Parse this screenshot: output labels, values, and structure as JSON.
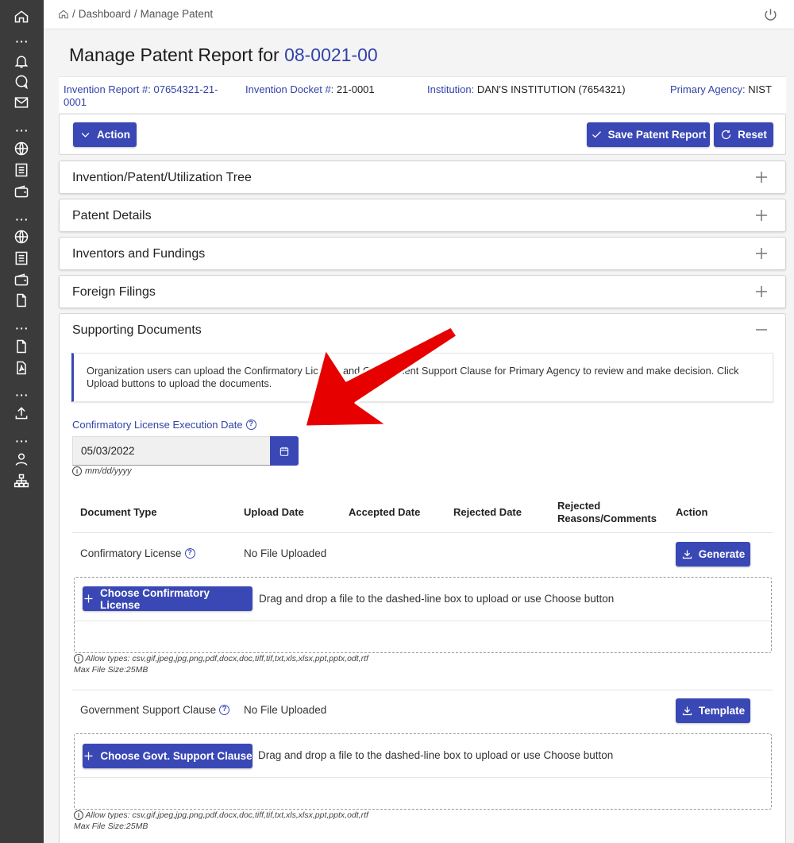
{
  "breadcrumb": {
    "dashboard": "Dashboard",
    "separator": "/",
    "current": "Manage Patent"
  },
  "page": {
    "title_prefix": "Manage Patent Report for",
    "title_id": "08-0021-00"
  },
  "info": {
    "invention_report_key": "Invention Report #:",
    "invention_report_value_line1": "07654321-21-",
    "invention_report_value_line2": "0001",
    "docket_key": "Invention Docket #:",
    "docket_value": "21-0001",
    "institution_key": "Institution:",
    "institution_value": "DAN'S INSTITUTION (7654321)",
    "agency_key": "Primary Agency:",
    "agency_value": "NIST"
  },
  "toolbar": {
    "action_label": "Action",
    "save_label": "Save Patent Report",
    "reset_label": "Reset"
  },
  "sections": [
    {
      "label": "Invention/Patent/Utilization Tree",
      "expanded": false
    },
    {
      "label": "Patent Details",
      "expanded": false
    },
    {
      "label": "Inventors and Fundings",
      "expanded": false
    },
    {
      "label": "Foreign Filings",
      "expanded": false
    },
    {
      "label": "Supporting Documents",
      "expanded": true
    }
  ],
  "supporting": {
    "notice_line1": "Organization users can upload the Confirmatory License and Government Support Clause for Primary Agency to review and make decision. Click",
    "notice_line2": "Upload buttons to upload the documents.",
    "date_label": "Confirmatory License Execution Date",
    "date_value": "05/03/2022",
    "date_hint": "mm/dd/yyyy",
    "columns": [
      "Document Type",
      "Upload Date",
      "Accepted Date",
      "Rejected Date",
      "Rejected",
      "Reasons/Comments",
      "Action"
    ],
    "rows": [
      {
        "type": "Confirmatory License",
        "upload": "No File Uploaded",
        "action": "Generate",
        "choose_label": "Choose Confirmatory License",
        "drop_text": "Drag and drop a file to the dashed-line box to upload or use Choose button",
        "allow_types": "Allow types: csv,gif,jpeg,jpg,png,pdf,docx,doc,tiff,tif,txt,xls,xlsx,ppt,pptx,odt,rtf",
        "max_size": "Max File Size:25MB"
      },
      {
        "type": "Government Support Clause",
        "upload": "No File Uploaded",
        "action": "Template",
        "choose_label": "Choose Govt. Support Clause",
        "drop_text": "Drag and drop a file to the dashed-line box to upload or use Choose button",
        "allow_types": "Allow types: csv,gif,jpeg,jpg,png,pdf,docx,doc,tiff,tif,txt,xls,xlsx,ppt,pptx,odt,rtf",
        "max_size": "Max File Size:25MB"
      }
    ]
  },
  "sidebar": {
    "icons": [
      "home-icon",
      "bell-icon",
      "chat-icon",
      "mail-icon",
      "globe-icon",
      "list-icon",
      "wallet-icon",
      "globe-icon",
      "list-icon",
      "wallet-icon",
      "file-icon",
      "file-icon",
      "pdf-icon",
      "upload-icon",
      "user-icon",
      "org-chart-icon"
    ]
  },
  "colors": {
    "primary": "#3a48b5",
    "link": "#3343a7",
    "sidebar": "#3b3b3b",
    "annotation_arrow": "#e60000"
  }
}
